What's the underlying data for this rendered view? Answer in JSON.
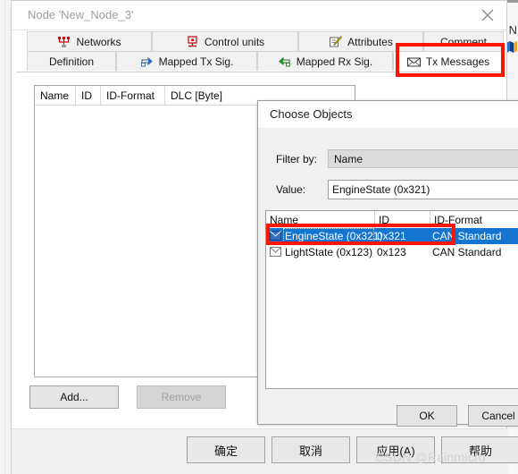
{
  "background_window": {
    "partial_title": "N"
  },
  "node_dialog": {
    "title": "Node 'New_Node_3'",
    "close_icon": "close-icon",
    "tabs_row1": [
      {
        "label": "Networks",
        "icon": "network-icon",
        "active": false
      },
      {
        "label": "Control units",
        "icon": "control-unit-icon",
        "active": false
      },
      {
        "label": "Attributes",
        "icon": "attributes-icon",
        "active": false
      },
      {
        "label": "Comment",
        "icon": "none",
        "active": false
      }
    ],
    "tabs_row2": [
      {
        "label": "Definition",
        "icon": "none",
        "active": false
      },
      {
        "label": "Mapped Tx Sig.",
        "icon": "mapped-tx-icon",
        "active": false
      },
      {
        "label": "Mapped Rx Sig.",
        "icon": "mapped-rx-icon",
        "active": false
      },
      {
        "label": "Tx Messages",
        "icon": "envelope-icon",
        "active": true
      }
    ],
    "grid": {
      "columns": [
        "Name",
        "ID",
        "ID-Format",
        "DLC [Byte]"
      ],
      "rows": []
    },
    "add_button": "Add...",
    "remove_button": "Remove",
    "footer_buttons": [
      "确定",
      "取消",
      "应用(A)",
      "帮助"
    ]
  },
  "choose_objects_dialog": {
    "title": "Choose Objects",
    "filter_by_label": "Filter by:",
    "filter_by_value": "Name",
    "value_label": "Value:",
    "value_text": "EngineState (0x321)",
    "list": {
      "columns": [
        "Name",
        "ID",
        "ID-Format"
      ],
      "rows": [
        {
          "icon": "envelope-icon",
          "name": "EngineState (0x321)",
          "id": "0x321",
          "id_format": "CAN Standard",
          "selected": true
        },
        {
          "icon": "envelope-icon",
          "name": "LightState (0x123)",
          "id": "0x123",
          "id_format": "CAN Standard",
          "selected": false
        }
      ]
    },
    "ok_button": "OK",
    "cancel_button": "Cancel"
  },
  "annotations": {
    "highlight_color": "#ff1400",
    "boxes": [
      "tx-messages-tab",
      "selected-list-row"
    ]
  },
  "watermark": "CSDN @Rainmicro"
}
